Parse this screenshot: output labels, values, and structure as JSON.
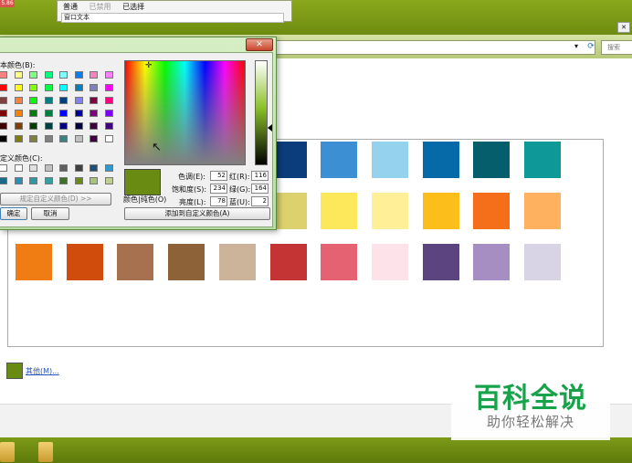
{
  "settings_panel": {
    "badge": "5.86",
    "options": [
      "普通",
      "已禁用",
      "已选择"
    ],
    "field_text": "窗口文本"
  },
  "main_window": {
    "search_placeholder": "搜索",
    "close_glyph": "✕",
    "swatches": [
      [
        "#ffffff",
        "#ffffff",
        "#ffffff",
        "#ffffff",
        "#ffffff",
        "#0b3d7c",
        "#3d8fd4",
        "#94d2ee",
        "#066aa8",
        "#045e6b",
        "#0e9898"
      ],
      [
        "#ffffff",
        "#ffffff",
        "#ffffff",
        "#ffffff",
        "#ffffff",
        "#dcd16c",
        "#fde85c",
        "#fff098",
        "#fcbe1a",
        "#f56e1a",
        "#feb15f"
      ],
      [
        "#f07c14",
        "#d04c0c",
        "#a7704f",
        "#8e6238",
        "#cbb49a",
        "#c53434",
        "#e46272",
        "#fde2ea",
        "#5c4480",
        "#a68dc2",
        "#d8d3e5"
      ]
    ],
    "current_color": "#698b11",
    "other_link": "其他(M)..."
  },
  "watermark": {
    "title": "百科全说",
    "subtitle": "助你轻松解决"
  },
  "color_dialog": {
    "close_glyph": "✕",
    "basic_colors_label": "本颜色(B):",
    "basic_colors": [
      [
        "#ff8080",
        "#ffff80",
        "#80ff80",
        "#00ff80",
        "#80ffff",
        "#0080ff",
        "#ff80c0",
        "#ff80ff"
      ],
      [
        "#ff0000",
        "#ffff00",
        "#80ff00",
        "#00ff40",
        "#00ffff",
        "#0080c0",
        "#8080c0",
        "#ff00ff"
      ],
      [
        "#804040",
        "#ff8040",
        "#00ff00",
        "#008080",
        "#004080",
        "#8080ff",
        "#800040",
        "#ff0080"
      ],
      [
        "#800000",
        "#ff8000",
        "#008000",
        "#008040",
        "#0000ff",
        "#0000a0",
        "#800080",
        "#8000ff"
      ],
      [
        "#400000",
        "#804000",
        "#004000",
        "#004040",
        "#000080",
        "#000040",
        "#400040",
        "#400080"
      ],
      [
        "#000000",
        "#808000",
        "#808040",
        "#808080",
        "#408080",
        "#c0c0c0",
        "#400040",
        "#ffffff"
      ]
    ],
    "custom_colors_label": "定义颜色(C):",
    "custom_colors": [
      [
        "#ffffff",
        "#ffffff",
        "#e0e0e0",
        "#c0c0c0",
        "#606060",
        "#404040",
        "#1f4e79",
        "#3399cc"
      ],
      [
        "#1a6b8a",
        "#2a8fb0",
        "#2b9ca6",
        "#36a0a0",
        "#3f6f2a",
        "#698b11",
        "#a6c47a",
        "#c0d090"
      ]
    ],
    "define_button": "规定自定义颜色(D) >>",
    "ok_button": "确定",
    "cancel_button": "取消",
    "color_solid_label": "颜色|纯色(O)",
    "add_button": "添加到自定义颜色(A)",
    "preview_color": "#698b11",
    "crosshair_glyph": "✛",
    "cursor_glyph": "↖",
    "fields": {
      "hue_label": "色调(E):",
      "hue": "52",
      "sat_label": "饱和度(S):",
      "sat": "234",
      "lum_label": "亮度(L):",
      "lum": "78",
      "red_label": "红(R):",
      "red": "116",
      "green_label": "绿(G):",
      "green": "164",
      "blue_label": "蓝(U):",
      "blue": "2"
    }
  }
}
